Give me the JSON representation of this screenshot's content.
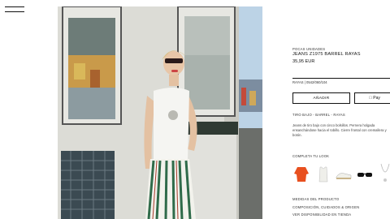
{
  "product": {
    "tag": "POCAS UNIDADES",
    "name": "JEANS Z1975 BARREL RAYAS",
    "price": "35,95 EUR",
    "color_ref": "RAYAS | 0542/060/104",
    "add_label": "AÑADIR",
    "apple_pay_label": "Pay",
    "fit": "TIRO BAJO - BARREL - RAYAS",
    "description": "Jeans de tiro bajo con cinco bolsillos. Pernera holgada ensanchándose hacia el tobillo. Cierre frontal con cremallera y botón."
  },
  "complete_look": {
    "heading": "COMPLETA TU LOOK",
    "items": [
      {
        "icon": "orange-sweater"
      },
      {
        "icon": "white-tank-top"
      },
      {
        "icon": "white-sneaker"
      },
      {
        "icon": "sunglasses"
      },
      {
        "icon": "necklace"
      }
    ]
  },
  "links": [
    {
      "label": "MEDIDAS DEL PRODUCTO"
    },
    {
      "label": "COMPOSICIÓN, CUIDADOS & ORIGEN"
    },
    {
      "label": "VER DISPONIBILIDAD EN TIENDA"
    }
  ],
  "colors": {
    "text": "#111111",
    "background": "#ffffff"
  }
}
